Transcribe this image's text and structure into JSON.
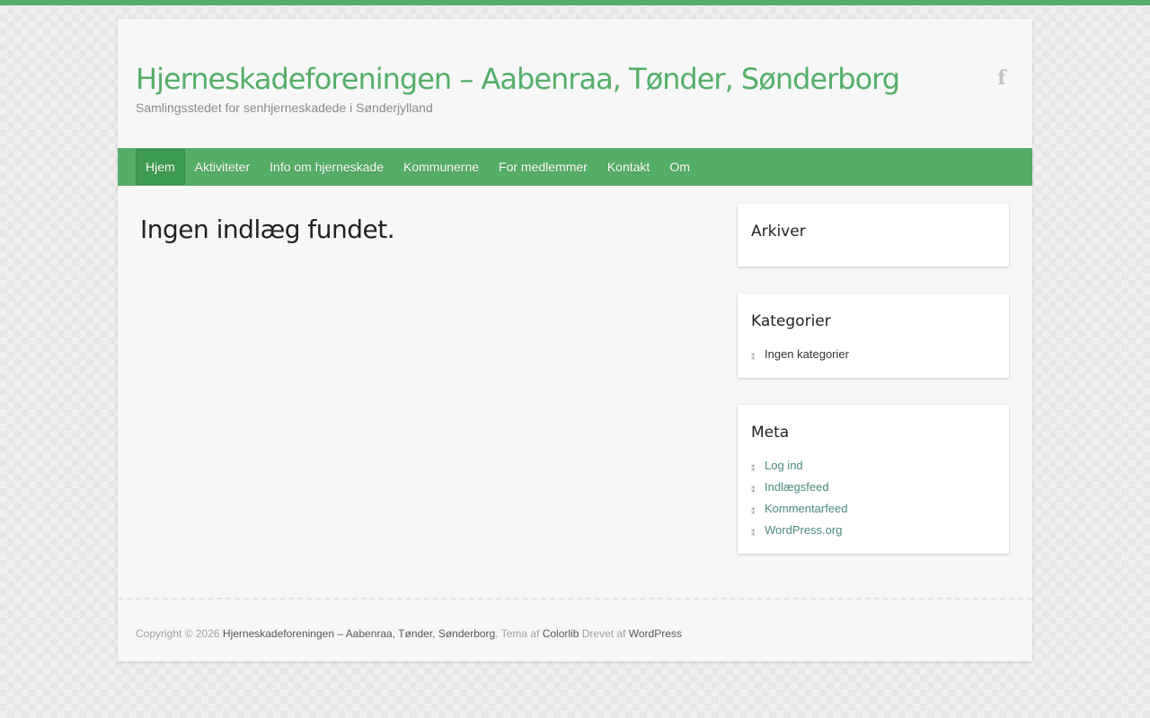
{
  "site": {
    "title": "Hjerneskadeforeningen – Aabenraa, Tønder, Sønderborg",
    "description": "Samlingsstedet for senhjerneskadede i Sønderjylland",
    "social_icon": "facebook-icon"
  },
  "nav": {
    "items": [
      {
        "label": "Hjem"
      },
      {
        "label": "Aktiviteter"
      },
      {
        "label": "Info om hjerneskade"
      },
      {
        "label": "Kommunerne"
      },
      {
        "label": "For medlemmer"
      },
      {
        "label": "Kontakt"
      },
      {
        "label": "Om"
      }
    ],
    "active": "Hjem"
  },
  "main": {
    "heading": "Ingen indlæg fundet."
  },
  "sidebar": {
    "archives": {
      "title": "Arkiver"
    },
    "categories": {
      "title": "Kategorier",
      "items": [
        "Ingen kategorier"
      ]
    },
    "meta": {
      "title": "Meta",
      "items": [
        "Log ind",
        "Indlægsfeed",
        "Kommentarfeed",
        "WordPress.org"
      ]
    }
  },
  "footer": {
    "copyright": "Copyright © 2026",
    "site_link": "Hjerneskadeforeningen – Aabenraa, Tønder, Sønderborg",
    "theme_text": ". Tema af",
    "theme_link": "Colorlib",
    "powered_text": "Drevet af",
    "powered_link": "WordPress"
  },
  "colors": {
    "accent": "#55ae68",
    "active_nav": "#3e9b52",
    "link": "#4a8a80"
  }
}
